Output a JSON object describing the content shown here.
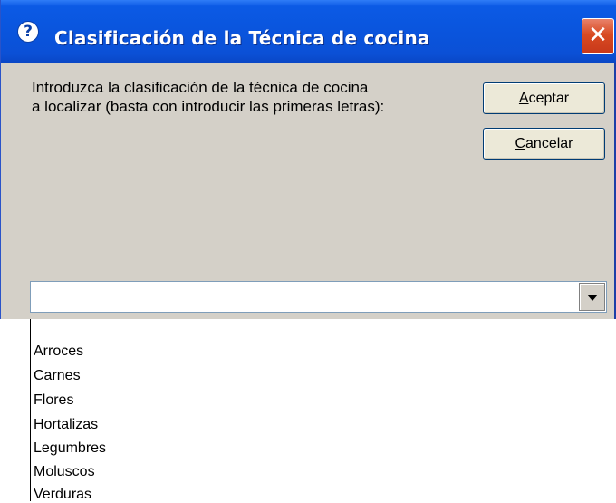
{
  "window": {
    "title": "Clasificación de la Técnica de cocina",
    "title_icon": "question-icon",
    "close_glyph": "✕",
    "accent_color": "#0a54dc",
    "face_color": "#d4d0c8"
  },
  "prompt": {
    "line1": "Introduzca la clasificación de la técnica de cocina",
    "line2": "a localizar (basta con introducir las primeras letras):"
  },
  "buttons": {
    "accept": {
      "mnemonic": "A",
      "rest": "ceptar"
    },
    "cancel": {
      "mnemonic": "C",
      "rest": "ancelar"
    }
  },
  "combo": {
    "value": "",
    "arrow_icon": "chevron-down-icon"
  },
  "dropdown": {
    "items": [
      "Arroces",
      "Carnes",
      "Flores",
      "Hortalizas",
      "Legumbres",
      "Moluscos",
      "Verduras"
    ]
  }
}
